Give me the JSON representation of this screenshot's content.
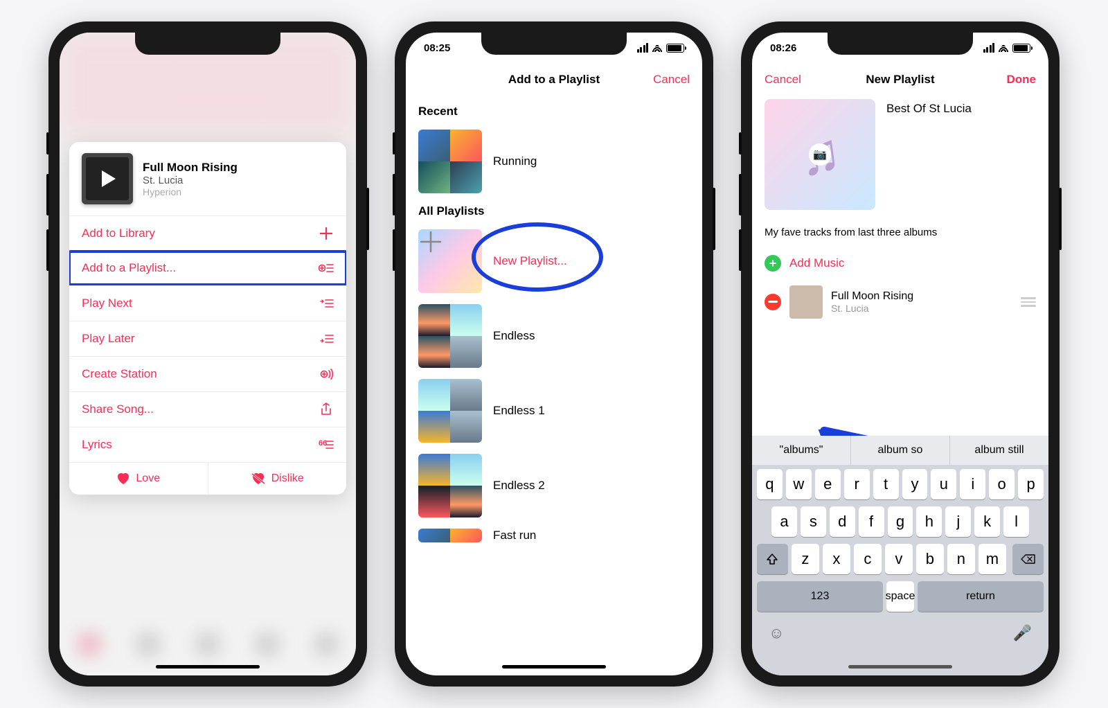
{
  "screen1": {
    "track": {
      "title": "Full Moon Rising",
      "artist": "St. Lucia",
      "album": "Hyperion"
    },
    "menu": {
      "add_library": "Add to Library",
      "add_playlist": "Add to a Playlist...",
      "play_next": "Play Next",
      "play_later": "Play Later",
      "create_station": "Create Station",
      "share_song": "Share Song...",
      "lyrics": "Lyrics"
    },
    "love": "Love",
    "dislike": "Dislike"
  },
  "screen2": {
    "time": "08:25",
    "title": "Add to a Playlist",
    "cancel": "Cancel",
    "section_recent": "Recent",
    "section_all": "All Playlists",
    "new_playlist": "New Playlist...",
    "playlists": {
      "running": "Running",
      "endless": "Endless",
      "endless1": "Endless 1",
      "endless2": "Endless 2",
      "fast_run": "Fast run"
    }
  },
  "screen3": {
    "time": "08:26",
    "cancel": "Cancel",
    "title": "New Playlist",
    "done": "Done",
    "name": "Best Of St Lucia",
    "desc": "My fave tracks from last three albums",
    "add_music": "Add Music",
    "track": {
      "title": "Full Moon Rising",
      "artist": "St. Lucia"
    },
    "suggestions": [
      "\"albums\"",
      "album so",
      "album still"
    ],
    "keys_r1": [
      "q",
      "w",
      "e",
      "r",
      "t",
      "y",
      "u",
      "i",
      "o",
      "p"
    ],
    "keys_r2": [
      "a",
      "s",
      "d",
      "f",
      "g",
      "h",
      "j",
      "k",
      "l"
    ],
    "keys_r3": [
      "z",
      "x",
      "c",
      "v",
      "b",
      "n",
      "m"
    ],
    "key_123": "123",
    "key_space": "space",
    "key_return": "return"
  }
}
